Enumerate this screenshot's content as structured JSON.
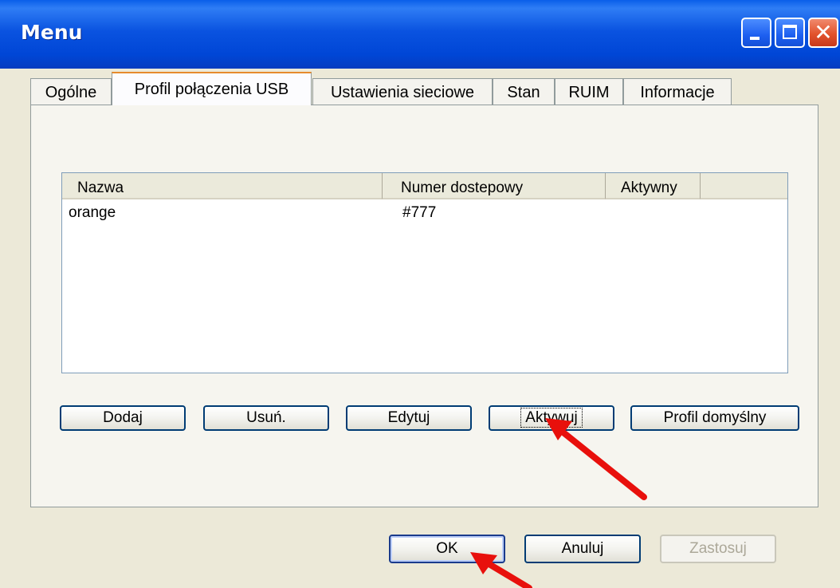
{
  "window": {
    "title": "Menu",
    "controls": [
      "minimize-icon",
      "maximize-icon",
      "close-icon"
    ]
  },
  "tabs": [
    {
      "label": "Ogólne",
      "active": false
    },
    {
      "label": "Profil połączenia USB",
      "active": true
    },
    {
      "label": "Ustawienia sieciowe",
      "active": false
    },
    {
      "label": "Stan",
      "active": false
    },
    {
      "label": "RUIM",
      "active": false
    },
    {
      "label": "Informacje",
      "active": false
    }
  ],
  "profiles": {
    "columns": [
      "Nazwa",
      "Numer dostepowy",
      "Aktywny"
    ],
    "rows": [
      {
        "name": "orange",
        "number": "#777",
        "active": ""
      }
    ]
  },
  "panel_buttons": {
    "add": "Dodaj",
    "remove": "Usuń.",
    "edit": "Edytuj",
    "activate": "Aktywuj",
    "default_profile": "Profil domyślny"
  },
  "dialog_buttons": {
    "ok": "OK",
    "cancel": "Anuluj",
    "apply": "Zastosuj"
  },
  "colors": {
    "title_bar": "#0054e3",
    "annotation_arrow": "#e8100c",
    "window_bg": "#ece9d8"
  }
}
